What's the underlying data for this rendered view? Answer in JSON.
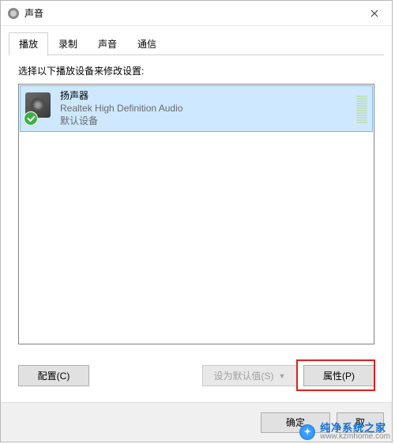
{
  "window": {
    "title": "声音"
  },
  "tabs": [
    {
      "label": "播放",
      "active": true
    },
    {
      "label": "录制",
      "active": false
    },
    {
      "label": "声音",
      "active": false
    },
    {
      "label": "通信",
      "active": false
    }
  ],
  "instruction": "选择以下播放设备来修改设置:",
  "device": {
    "name": "扬声器",
    "description": "Realtek High Definition Audio",
    "status": "默认设备"
  },
  "buttons": {
    "configure": "配置(C)",
    "set_default": "设为默认值(S)",
    "properties": "属性(P)",
    "ok": "确定",
    "cancel": "取"
  },
  "watermark": {
    "name": "纯净系统之家",
    "url": "www.kzmhome.com"
  }
}
